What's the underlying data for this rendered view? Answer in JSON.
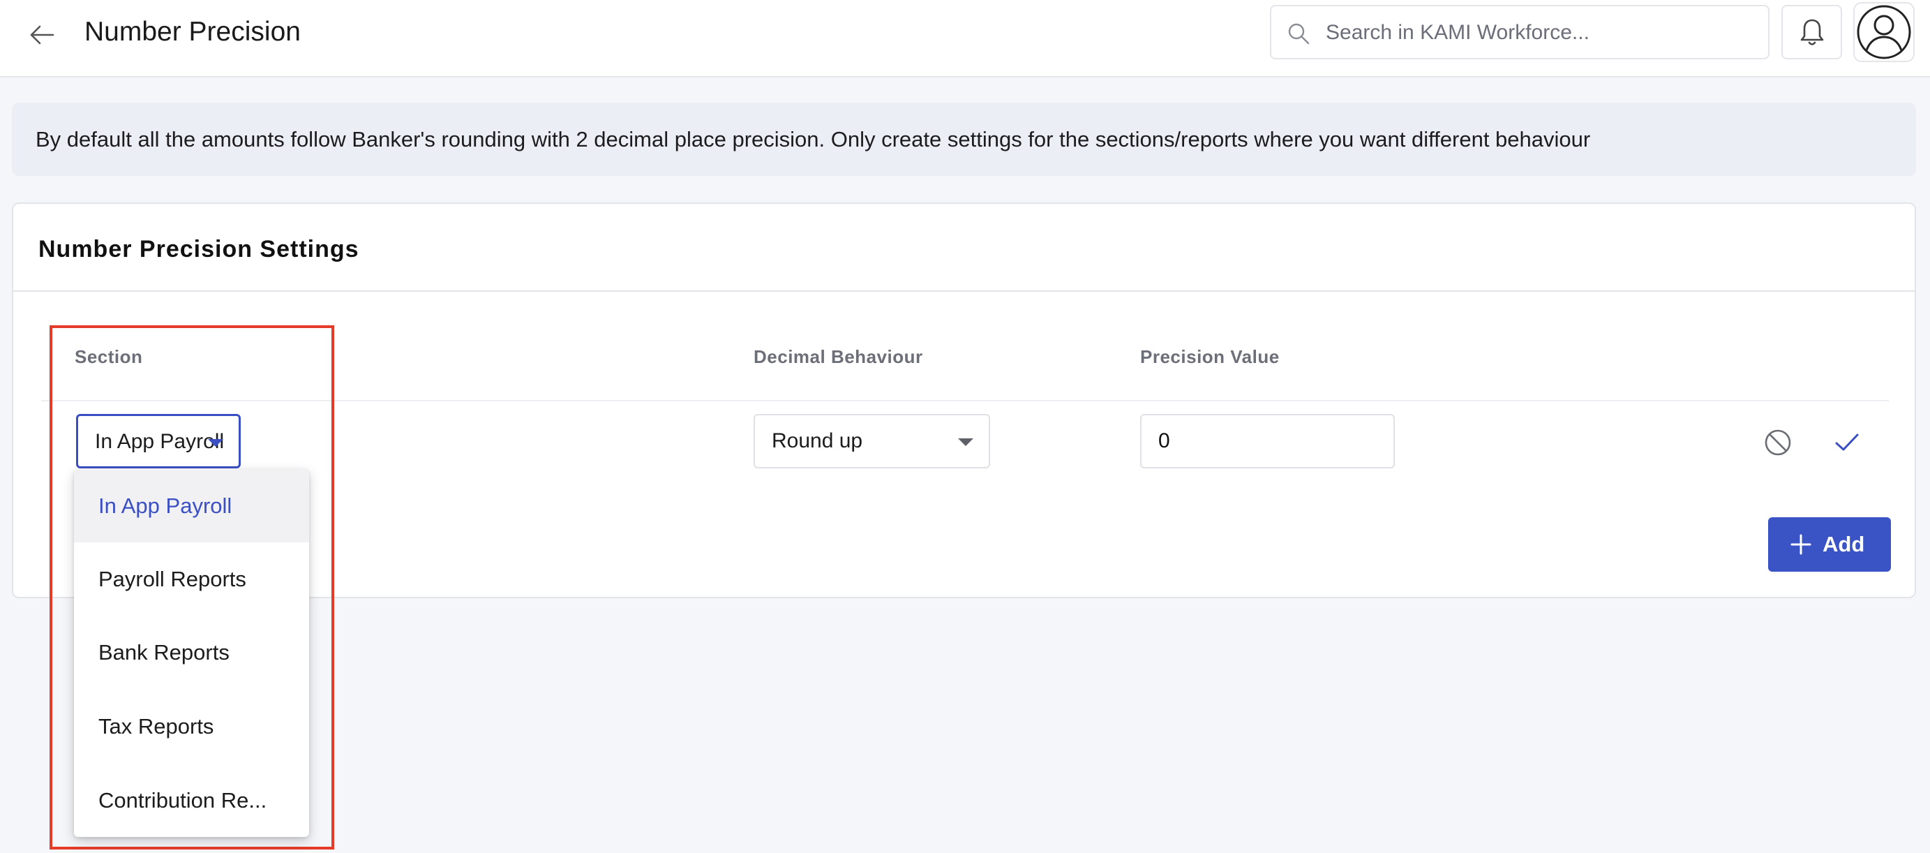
{
  "header": {
    "title": "Number Precision",
    "search_placeholder": "Search in KAMI Workforce..."
  },
  "info_banner": {
    "text": "By default all the amounts follow Banker's rounding with 2 decimal place precision. Only create settings for the sections/reports where you want different behaviour"
  },
  "settings": {
    "title": "Number Precision Settings",
    "columns": [
      "Section",
      "Decimal Behaviour",
      "Precision Value"
    ],
    "row": {
      "section": "In App Payroll",
      "decimal_behaviour": "Round up",
      "precision_value": "0"
    },
    "add_label": "Add"
  },
  "section_dropdown": {
    "selected": "In App Payroll",
    "options": [
      "In App Payroll",
      "Payroll Reports",
      "Bank Reports",
      "Tax Reports",
      "Contribution Re..."
    ]
  },
  "colors": {
    "accent": "#3b4fc4",
    "highlight": "#e53c2a",
    "banner_bg": "#eceef6"
  }
}
